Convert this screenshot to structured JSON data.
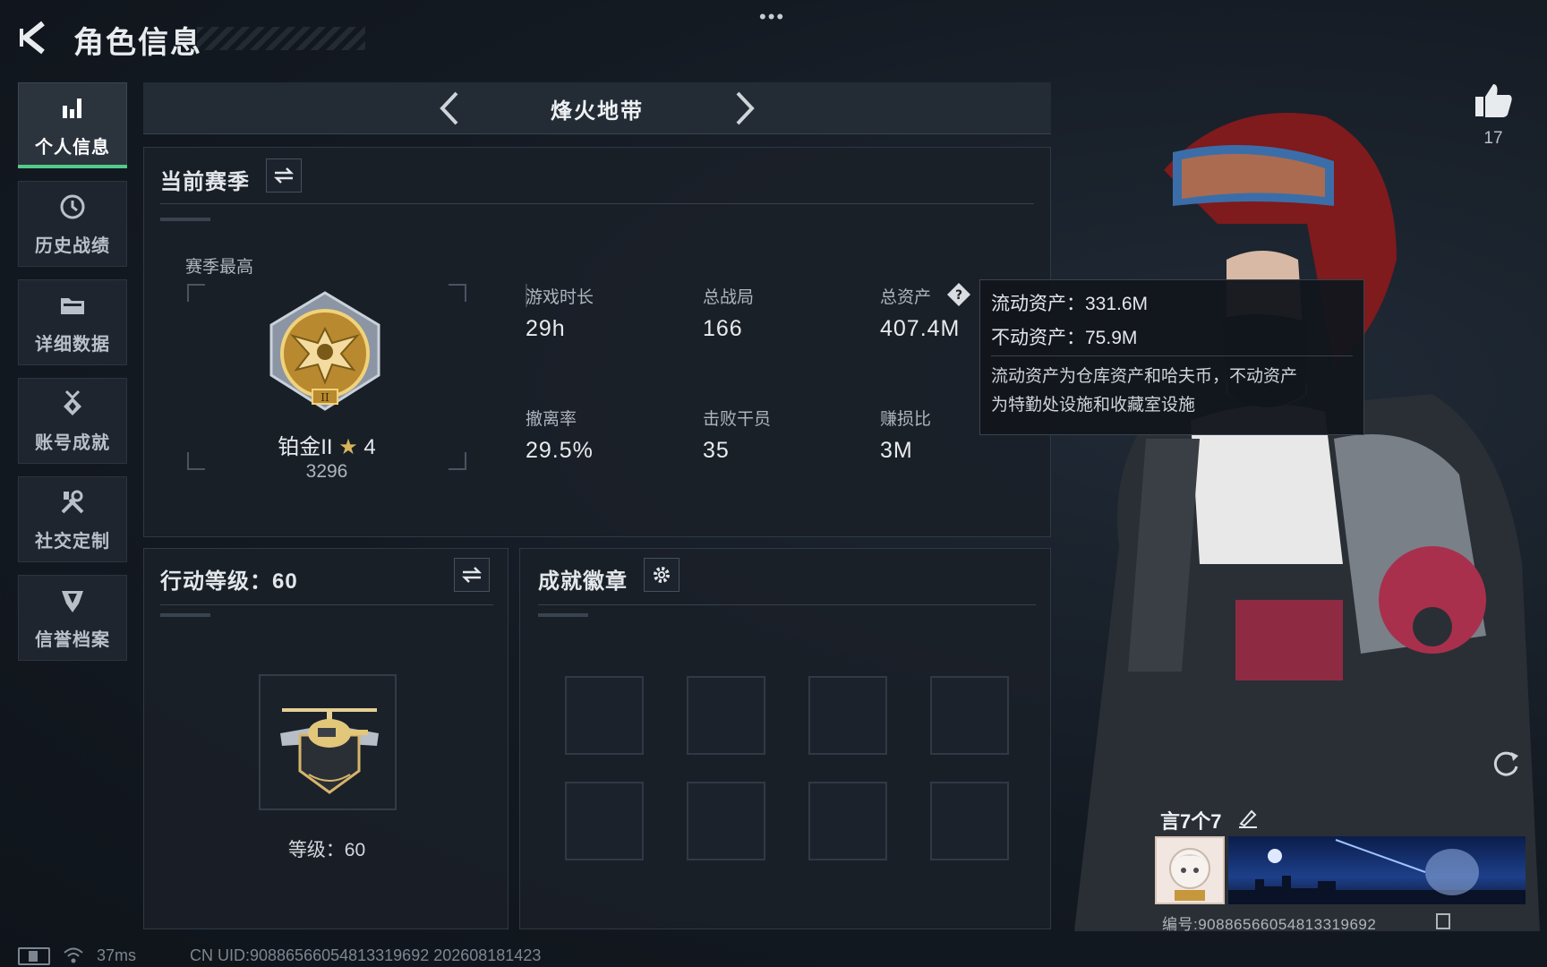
{
  "header": {
    "title": "角色信息",
    "dots": "•••"
  },
  "sidebar": {
    "items": [
      {
        "label": "个人信息",
        "icon": "bar-chart-icon"
      },
      {
        "label": "历史战绩",
        "icon": "history-clock-icon"
      },
      {
        "label": "详细数据",
        "icon": "folder-icon"
      },
      {
        "label": "账号成就",
        "icon": "medal-icon"
      },
      {
        "label": "社交定制",
        "icon": "tools-icon"
      },
      {
        "label": "信誉档案",
        "icon": "shield-emblem-icon"
      }
    ]
  },
  "mode": {
    "title": "烽火地带"
  },
  "season": {
    "heading": "当前赛季",
    "best_label": "赛季最高",
    "rank_name": "铂金II",
    "rank_stars": "4",
    "rank_score": "3296",
    "stats": [
      {
        "label": "游戏时长",
        "value": "29h"
      },
      {
        "label": "总战局",
        "value": "166"
      },
      {
        "label": "总资产",
        "value": "407.4M"
      },
      {
        "label": "撤离率",
        "value": "29.5%"
      },
      {
        "label": "击败干员",
        "value": "35"
      },
      {
        "label": "赚损比",
        "value": "3M"
      }
    ]
  },
  "tooltip": {
    "liquid": "流动资产：331.6M",
    "fixed": "不动资产：75.9M",
    "desc_line1": "流动资产为仓库资产和哈夫币，不动资产",
    "desc_line2": "为特勤处设施和收藏室设施"
  },
  "action_level": {
    "heading": "行动等级：60",
    "level_text": "等级：60"
  },
  "achievements": {
    "heading": "成就徽章"
  },
  "likes": {
    "count": "17"
  },
  "player": {
    "name": "言7个7",
    "id_text": "编号:9088656605481331969​2"
  },
  "status": {
    "ping": "37ms",
    "uid": "CN UID:9088656605481331969​2 202608181423"
  }
}
